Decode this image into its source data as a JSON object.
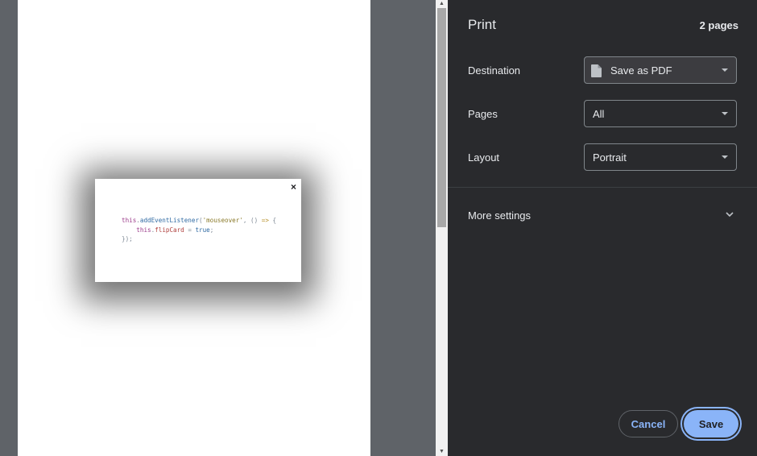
{
  "preview": {
    "modal": {
      "close_label": "×",
      "code_lines": [
        "this.addEventListener('mouseover', () => {",
        "    this.flipCard = true;",
        "});"
      ]
    },
    "scrollbar": {
      "up_arrow": "▲",
      "down_arrow": "▼"
    }
  },
  "panel": {
    "title": "Print",
    "page_count": "2 pages",
    "destination": {
      "label": "Destination",
      "value": "Save as PDF",
      "icon": "document-icon"
    },
    "pages": {
      "label": "Pages",
      "value": "All"
    },
    "layout": {
      "label": "Layout",
      "value": "Portrait"
    },
    "more_settings": {
      "label": "More settings",
      "icon": "chevron-down-icon"
    },
    "buttons": {
      "cancel": "Cancel",
      "save": "Save"
    }
  },
  "colors": {
    "panel_bg": "#292a2d",
    "accent": "#8ab4f8",
    "preview_bg": "#5f6368"
  }
}
